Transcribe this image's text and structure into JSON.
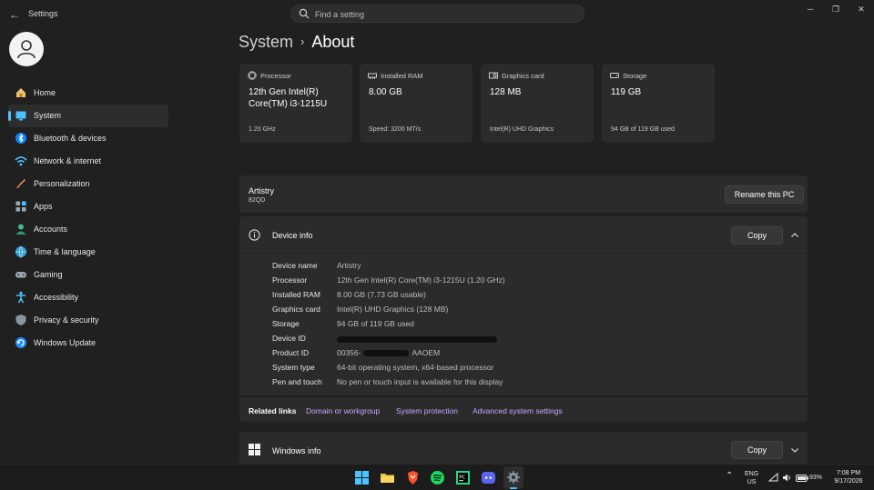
{
  "window": {
    "title": "Settings",
    "search_placeholder": "Find a setting",
    "controls": [
      "minimize-icon",
      "maximize-icon",
      "close-icon"
    ]
  },
  "sidebar": {
    "items": [
      {
        "label": "Home",
        "icon": "home-icon"
      },
      {
        "label": "System",
        "icon": "system-icon",
        "active": true
      },
      {
        "label": "Bluetooth & devices",
        "icon": "bluetooth-icon"
      },
      {
        "label": "Network & internet",
        "icon": "wifi-icon"
      },
      {
        "label": "Personalization",
        "icon": "brush-icon"
      },
      {
        "label": "Apps",
        "icon": "apps-icon"
      },
      {
        "label": "Accounts",
        "icon": "accounts-icon"
      },
      {
        "label": "Time & language",
        "icon": "globe-icon"
      },
      {
        "label": "Gaming",
        "icon": "gamepad-icon"
      },
      {
        "label": "Accessibility",
        "icon": "accessibility-icon"
      },
      {
        "label": "Privacy & security",
        "icon": "shield-icon"
      },
      {
        "label": "Windows Update",
        "icon": "update-icon"
      }
    ]
  },
  "breadcrumb": {
    "parent": "System",
    "separator": "›",
    "current": "About"
  },
  "specs": [
    {
      "label": "Processor",
      "value": "12th Gen Intel(R) Core(TM) i3-1215U",
      "footer": "1.20 GHz",
      "icon": "processor-icon"
    },
    {
      "label": "Installed RAM",
      "value": "8.00 GB",
      "footer": "Speed: 3200 MT/s",
      "icon": "ram-icon"
    },
    {
      "label": "Graphics card",
      "value": "128 MB",
      "footer": "Intel(R) UHD Graphics",
      "icon": "graphics-icon"
    },
    {
      "label": "Storage",
      "value": "119 GB",
      "footer": "94 GB of 119 GB used",
      "icon": "storage-icon"
    }
  ],
  "pc": {
    "name": "Artistry",
    "model": "82QD",
    "rename_label": "Rename this PC"
  },
  "device_info": {
    "title": "Device info",
    "copy_label": "Copy",
    "rows": [
      {
        "key": "Device name",
        "value": "Artistry"
      },
      {
        "key": "Processor",
        "value": "12th Gen Intel(R) Core(TM) i3-1215U (1.20 GHz)"
      },
      {
        "key": "Installed RAM",
        "value": "8.00 GB (7.73 GB usable)"
      },
      {
        "key": "Graphics card",
        "value": "Intel(R) UHD Graphics (128 MB)"
      },
      {
        "key": "Storage",
        "value": "94 GB of 119 GB used"
      },
      {
        "key": "Device ID",
        "value": ""
      },
      {
        "key": "Product ID",
        "value_prefix": "00356-",
        "value_suffix": "AAOEM"
      },
      {
        "key": "System type",
        "value": "64-bit operating system, x64-based processor"
      },
      {
        "key": "Pen and touch",
        "value": "No pen or touch input is available for this display"
      }
    ]
  },
  "related_links": {
    "title": "Related links",
    "links": [
      "Domain or workgroup",
      "System protection",
      "Advanced system settings"
    ]
  },
  "windows_info": {
    "title": "Windows info",
    "copy_label": "Copy"
  },
  "taskbar": {
    "apps": [
      "start-icon",
      "file-explorer-icon",
      "brave-icon",
      "spotify-icon",
      "pycharm-icon",
      "discord-icon",
      "settings-icon"
    ],
    "lang_top": "ENG",
    "lang_bottom": "US",
    "battery": "93%",
    "time": "7:08 PM",
    "date": "9/17/2026"
  },
  "colors": {
    "accent": "#4cc2ff",
    "link": "#c3a8ff",
    "card": "#2b2b2b",
    "background": "#202020"
  }
}
